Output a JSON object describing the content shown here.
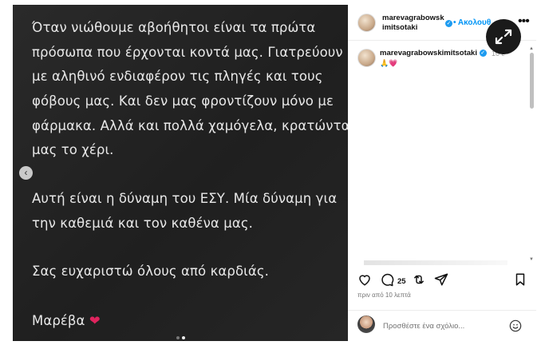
{
  "post": {
    "lines": [
      "Όταν νιώθουμε αβοήθητοι είναι τα πρώτα",
      "πρόσωπα που έρχονται κοντά μας. Γιατρεύουν",
      "με αληθινό ενδιαφέρον τις πληγές και τους",
      "φόβους μας. Και δεν μας φροντίζουν μόνο με",
      "φάρμακα. Αλλά και πολλά χαμόγελα, κρατώντας",
      "μας το χέρι.",
      "Αυτή είναι η δύναμη του ΕΣΥ. Μία δύναμη για",
      "την καθεμιά και τον καθένα μας.",
      "Σας ευχαριστώ όλους από καρδιάς.",
      "Μαρέβα"
    ],
    "signature_heart": "❤"
  },
  "header": {
    "username_line1": "marevagrabowsk",
    "username_line2": "imitsotaki",
    "follow_label": "• Ακολουθ",
    "more_label": "•••"
  },
  "caption": {
    "username": "marevagrabowskimitsotaki",
    "time": "10 ε",
    "emojis": "🙏💗"
  },
  "actions": {
    "comment_count": "25"
  },
  "posted_time": "πριν από 10 λεπτά",
  "comment_bar": {
    "placeholder": "Προσθέστε ένα σχόλιο..."
  },
  "colors": {
    "accent": "#0095f6",
    "post_bg": "#242424",
    "verified": "#1d9bf0"
  }
}
